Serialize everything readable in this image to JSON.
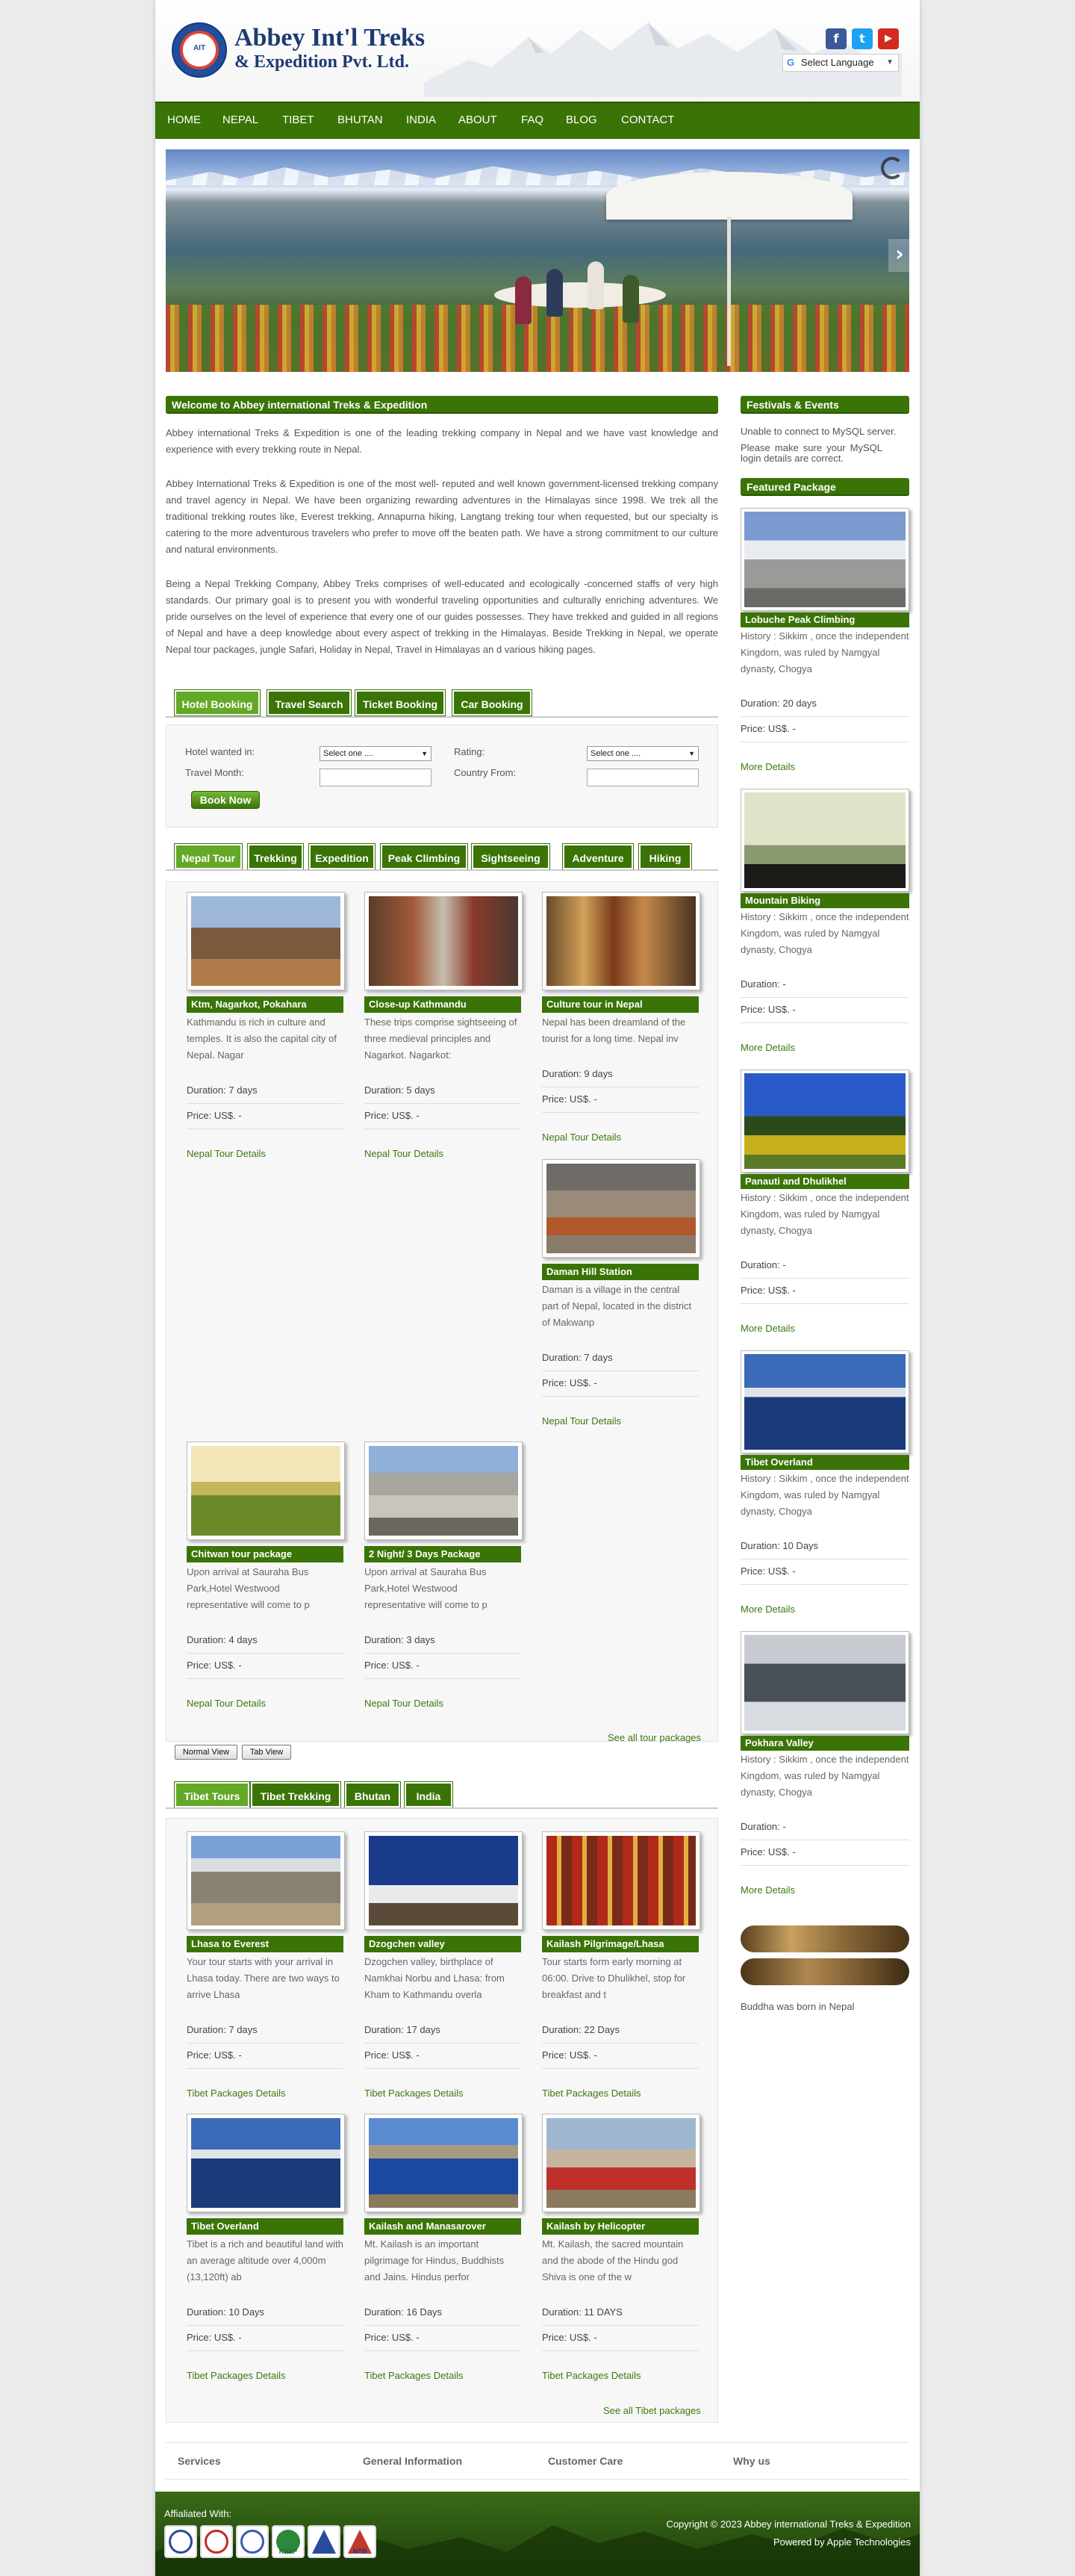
{
  "header": {
    "logo_seal_text": "AIT",
    "brand_line1": "Abbey Int'l Treks",
    "brand_line2": "& Expedition Pvt. Ltd.",
    "social": [
      "f",
      "t",
      "▶"
    ],
    "language": "Select Language"
  },
  "nav": [
    "HOME",
    "NEPAL",
    "TIBET",
    "BHUTAN",
    "INDIA",
    "ABOUT",
    "FAQ",
    "BLOG",
    "CONTACT"
  ],
  "welcome": {
    "heading": "Welcome to Abbey international Treks & Expedition",
    "p1": "Abbey international Treks & Expedition is one of the leading trekking company in Nepal and we have vast knowledge and experience with every trekking route in Nepal.",
    "p2": "Abbey International Treks & Expedition is one of the most well- reputed and well known government-licensed trekking company and travel agency  in Nepal. We have been organizing rewarding adventures in the Himalayas since 1998. We trek all the traditional trekking routes like, Everest trekking, Annapurna hiking, Langtang treking tour when requested, but our specialty is catering to the more adventurous travelers who prefer to move off the beaten path. We have a strong commitment to our culture and natural environments.",
    "p3": "Being a Nepal Trekking Company, Abbey Treks comprises of well-educated and ecologically -concerned staffs of very high standards. Our primary goal is to present you with wonderful traveling opportunities and culturally enriching adventures. We pride ourselves on the level of experience that every one of our guides possesses. They have trekked and guided in all regions of Nepal and have a deep knowledge about every aspect of trekking in the Himalayas. Beside Trekking in Nepal, we operate Nepal tour packages, jungle Safari, Holiday in Nepal, Travel in Himalayas an d various hiking pages."
  },
  "booking": {
    "tabs": [
      "Hotel Booking",
      "Travel Search",
      "Ticket Booking",
      "Car Booking"
    ],
    "hotel_label": "Hotel wanted in:",
    "hotel_value": "Select one ....",
    "rating_label": "Rating:",
    "rating_value": "Select one ....",
    "month_label": "Travel Month:",
    "country_label": "Country From:",
    "button": "Book Now"
  },
  "nepal": {
    "tabs": [
      "Nepal Tour",
      "Trekking",
      "Expedition",
      "Peak Climbing",
      "Sightseeing",
      "Adventure",
      "Hiking"
    ],
    "cards": [
      {
        "title": "Ktm, Nagarkot, Pokahara",
        "desc": "Kathmandu is rich in culture and temples. It is also the capital city of Nepal. Nagar",
        "duration": "Duration: 7 days",
        "price": "Price: US$. -",
        "link": "Nepal Tour Details"
      },
      {
        "title": "Close-up Kathmandu",
        "desc": "These trips comprise sightseeing of three medieval principles and Nagarkot. Nagarkot:",
        "duration": "Duration: 5 days",
        "price": "Price: US$. -",
        "link": "Nepal Tour Details"
      },
      {
        "title": "Culture tour in Nepal",
        "desc": "Nepal has been dreamland of the tourist for a long time. Nepal inv",
        "duration": "Duration: 9 days",
        "price": "Price: US$. -",
        "link": "Nepal Tour Details"
      },
      {
        "title": "Daman Hill Station",
        "desc": "Daman is a village in the central part of Nepal, located in the district of Makwanp",
        "duration": "Duration: 7 days",
        "price": "Price: US$. -",
        "link": "Nepal Tour Details"
      },
      {
        "title": "Chitwan tour package",
        "desc": "Upon arrival at Sauraha Bus Park,Hotel Westwood representative will come to p",
        "duration": "Duration: 4 days",
        "price": "Price: US$. -",
        "link": "Nepal Tour Details"
      },
      {
        "title": "2 Night/ 3 Days Package",
        "desc": "Upon arrival at Sauraha Bus Park,Hotel Westwood representative will come to p",
        "duration": "Duration: 3 days",
        "price": "Price: US$. -",
        "link": "Nepal Tour Details"
      }
    ],
    "see_all": "See all tour packages",
    "normal_view": "Normal View",
    "tab_view": "Tab View"
  },
  "tibet": {
    "tabs": [
      "Tibet Tours",
      "Tibet Trekking",
      "Bhutan",
      "India"
    ],
    "cards": [
      {
        "title": "Lhasa to Everest",
        "desc": "Your tour starts with your arrival in Lhasa today. There are two ways to arrive Lhasa",
        "duration": "Duration: 7 days",
        "price": "Price: US$. -",
        "link": "Tibet Packages Details"
      },
      {
        "title": "Dzogchen valley",
        "desc": "Dzogchen valley, birthplace of Namkhai Norbu and Lhasa: from Kham to Kathmandu overla",
        "duration": "Duration: 17 days",
        "price": "Price: US$. -",
        "link": "Tibet Packages Details"
      },
      {
        "title": "Kailash Pilgrimage/Lhasa",
        "desc": "Tour starts form early morning at 06:00. Drive to Dhulikhel, stop for breakfast and t",
        "duration": "Duration: 22 Days",
        "price": "Price: US$. -",
        "link": "Tibet Packages Details"
      },
      {
        "title": "Tibet Overland",
        "desc": "Tibet is a rich and beautiful land with an average altitude over 4,000m (13,120ft) ab",
        "duration": "Duration: 10 Days",
        "price": "Price: US$. -",
        "link": "Tibet Packages Details"
      },
      {
        "title": "Kailash and Manasarover",
        "desc": "Mt. Kailash is an important pilgrimage for Hindus, Buddhists and Jains. Hindus perfor",
        "duration": "Duration: 16 Days",
        "price": "Price: US$. -",
        "link": "Tibet Packages Details"
      },
      {
        "title": "Kailash by Helicopter",
        "desc": "Mt. Kailash, the sacred mountain and the abode of the Hindu god Shiva is one of the w",
        "duration": "Duration: 11 DAYS",
        "price": "Price: US$. -",
        "link": "Tibet Packages Details"
      }
    ],
    "see_all": "See all Tibet packages"
  },
  "sidebar": {
    "festivals_heading": "Festivals & Events",
    "festivals_error1": "Unable to connect to MySQL server.",
    "festivals_error2": "Please make sure your MySQL login details are correct.",
    "featured_heading": "Featured Package",
    "items": [
      {
        "title": "Lobuche Peak Climbing",
        "desc": "History : Sikkim , once the independent Kingdom, was ruled by Namgyal dynasty, Chogya",
        "duration": "Duration: 20 days",
        "price": "Price: US$. -",
        "link": "More Details"
      },
      {
        "title": "Mountain Biking",
        "desc": "History : Sikkim , once the independent Kingdom, was ruled by Namgyal dynasty, Chogya",
        "duration": "Duration: -",
        "price": "Price: US$. -",
        "link": "More Details"
      },
      {
        "title": "Panauti and Dhulikhel",
        "desc": "History : Sikkim , once the independent Kingdom, was ruled by Namgyal dynasty, Chogya",
        "duration": "Duration: -",
        "price": "Price: US$. -",
        "link": "More Details"
      },
      {
        "title": "Tibet Overland",
        "desc": "History : Sikkim , once the independent Kingdom, was ruled by Namgyal dynasty, Chogya",
        "duration": "Duration: 10 Days",
        "price": "Price: US$. -",
        "link": "More Details"
      },
      {
        "title": "Pokhara Valley",
        "desc": "History : Sikkim , once the independent Kingdom, was ruled by Namgyal dynasty, Chogya",
        "duration": "Duration: -",
        "price": "Price: US$. -",
        "link": "More Details"
      }
    ],
    "buddha_caption": "Buddha was born in Nepal"
  },
  "footer": {
    "columns": [
      "Services",
      "General Information",
      "Customer Care",
      "Why us"
    ],
    "affiliated": "Affialiated With:",
    "affiliate_badges": [
      "",
      "",
      "",
      "KEEP",
      "",
      "NTB"
    ],
    "copyright": "Copyright © 2023 Abbey international Treks & Expedition",
    "powered": "Powered by Apple Technologies"
  },
  "colors": {
    "brand_green": "#3a7406",
    "active_tab": "#63a827",
    "brand_blue": "#1f3a73"
  }
}
